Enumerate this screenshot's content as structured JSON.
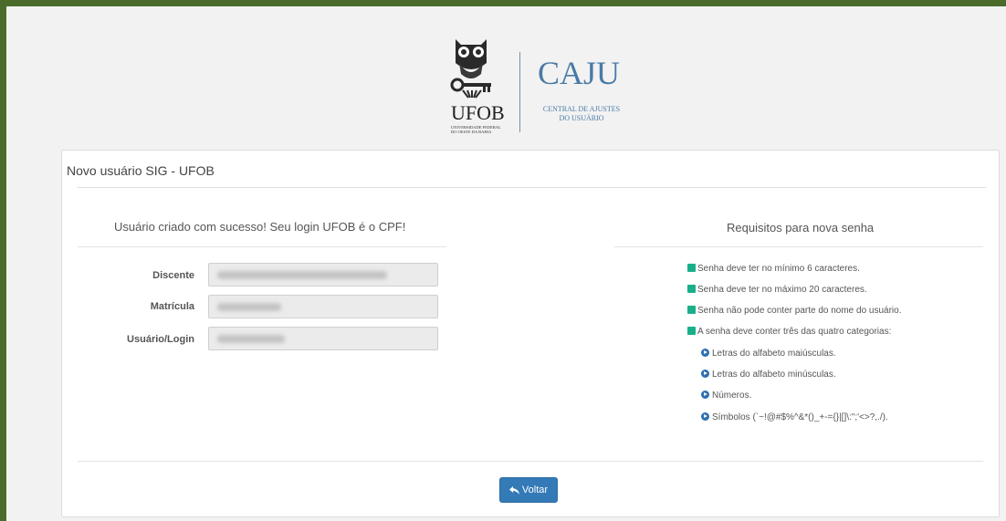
{
  "logo": {
    "org_name": "UFOB",
    "org_subtitle": "Universidade Federal do Oeste da Bahia",
    "app_name": "CAJU",
    "app_subtitle_line1": "CENTRAL DE AJUSTES",
    "app_subtitle_line2": "DO USUÁRIO"
  },
  "panel": {
    "title": "Novo usuário SIG - UFOB"
  },
  "success": {
    "message": "Usuário criado com sucesso! Seu login UFOB é o CPF!",
    "fields": [
      {
        "label": "Discente"
      },
      {
        "label": "Matrícula"
      },
      {
        "label": "Usuário/Login"
      }
    ]
  },
  "requirements": {
    "title": "Requisitos para nova senha",
    "items": [
      "Senha deve ter no mínimo 6 caracteres.",
      "Senha deve ter no máximo 20 caracteres.",
      "Senha não pode conter parte do nome do usuário.",
      "A senha deve conter três das quatro categorias:"
    ],
    "categories": [
      "Letras do alfabeto maiúsculas.",
      "Letras do alfabeto minúsculas.",
      "Números.",
      "Símbolos (`~!@#$%^&*()_+-={}|[]\\:\";'<>?,./)."
    ]
  },
  "actions": {
    "back_label": "Voltar"
  },
  "colors": {
    "frame": "#4a6b2a",
    "brand": "#4a7aa6",
    "check": "#1aaf8b",
    "button": "#337ab7"
  }
}
